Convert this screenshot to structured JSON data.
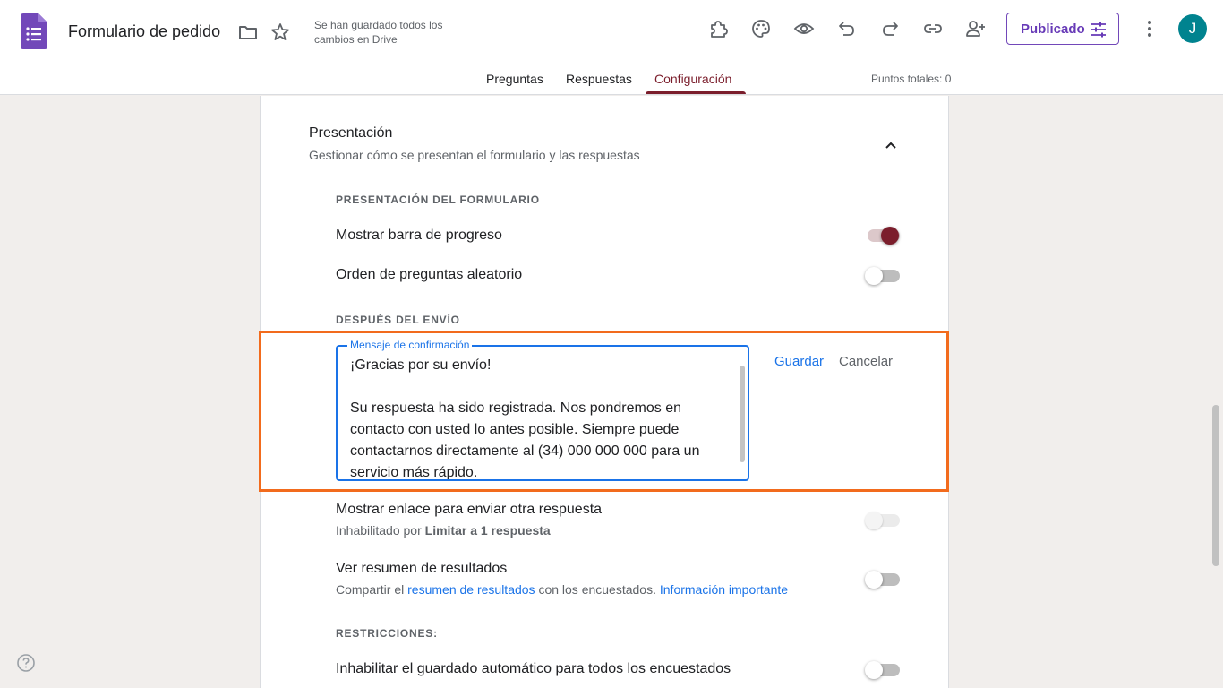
{
  "header": {
    "title": "Formulario de pedido",
    "save_status": "Se han guardado todos los cambios en Drive",
    "publish_label": "Publicado",
    "avatar_letter": "J",
    "total_points": "Puntos totales: 0"
  },
  "tabs": [
    {
      "label": "Preguntas",
      "active": false
    },
    {
      "label": "Respuestas",
      "active": false
    },
    {
      "label": "Configuración",
      "active": true
    }
  ],
  "icons": [
    "forms-logo-icon",
    "folder-icon",
    "star-icon",
    "addon-puzzle-icon",
    "palette-icon",
    "preview-eye-icon",
    "undo-icon",
    "redo-icon",
    "link-icon",
    "add-collaborator-icon",
    "sliders-icon",
    "more-vert-icon",
    "chevron-up-icon",
    "help-icon"
  ],
  "colors": {
    "accent": "#7b1e2c",
    "brand": "#673ab7",
    "link": "#1a73e8",
    "highlight": "#f26b1d"
  },
  "section": {
    "title": "Presentación",
    "subtitle": "Gestionar cómo se presentan el formulario y las respuestas",
    "form_presentation_heading": "PRESENTACIÓN DEL FORMULARIO",
    "progress_bar_label": "Mostrar barra de progreso",
    "progress_bar_on": true,
    "shuffle_label": "Orden de preguntas aleatorio",
    "shuffle_on": false,
    "after_submit_heading": "DESPUÉS DEL ENVÍO",
    "confirmation": {
      "legend": "Mensaje de confirmación",
      "text": "¡Gracias por su envío!\n\nSu respuesta ha sido registrada. Nos pondremos en contacto con usted lo antes posible. Siempre puede contactarnos directamente al (34) 000 000 000 para un servicio más rápido.",
      "save_label": "Guardar",
      "cancel_label": "Cancelar"
    },
    "another_response": {
      "label": "Mostrar enlace para enviar otra respuesta",
      "sub_prefix": "Inhabilitado por",
      "sub_bold": "Limitar a 1 respuesta",
      "enabled": false
    },
    "results_summary": {
      "label": "Ver resumen de resultados",
      "sub_prefix": "Compartir el",
      "sub_link": "resumen de resultados",
      "sub_middle": "con los encuestados.",
      "sub_link2": "Información importante",
      "on": false
    },
    "restrictions_heading": "RESTRICCIONES:",
    "autosave_label": "Inhabilitar el guardado automático para todos los encuestados",
    "autosave_on": false
  }
}
